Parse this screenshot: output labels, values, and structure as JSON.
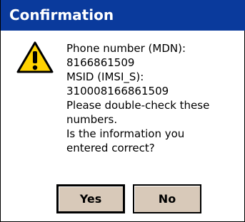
{
  "dialog": {
    "title": "Confirmation",
    "icon": "warning-icon",
    "message_lines": [
      "Phone number (MDN):",
      "8166861509",
      "MSID (IMSI_S):",
      "310008166861509",
      "Please double-check these",
      "numbers.",
      "Is the information you",
      "entered correct?"
    ],
    "buttons": {
      "yes_label": "Yes",
      "no_label": "No"
    }
  },
  "colors": {
    "titlebar": "#0a3a9c",
    "button_face": "#d8c9b9",
    "warning_yellow": "#ffd200"
  }
}
